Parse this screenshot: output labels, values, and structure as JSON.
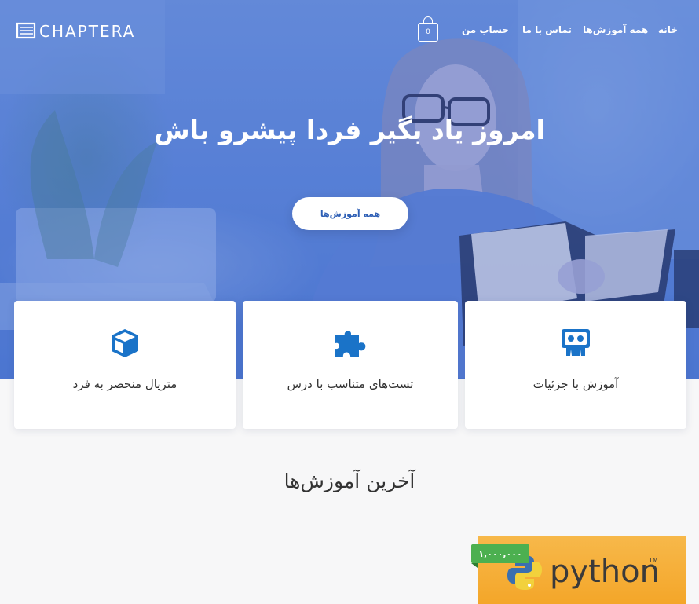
{
  "header": {
    "logo_text": "CHAPTERA",
    "cart_count": "0",
    "nav": {
      "home": "خانه",
      "all_courses": "همه آموزش‌ها",
      "contact": "تماس با ما",
      "account": "حساب من"
    }
  },
  "hero": {
    "title": "امروز یاد بگیر فردا پیشرو باش",
    "button_label": "همه آموزش‌ها"
  },
  "features": [
    {
      "label": "متریال منحصر به فرد",
      "icon": "cube-icon"
    },
    {
      "label": "تست‌های متناسب با درس",
      "icon": "puzzle-icon"
    },
    {
      "label": "آموزش با جزئیات",
      "icon": "presentation-icon"
    }
  ],
  "latest": {
    "title": "آخرین آموزش‌ها",
    "courses": [
      {
        "image_text": "python",
        "trademark": "TM",
        "price": "۱,۰۰۰,۰۰۰"
      }
    ]
  },
  "colors": {
    "accent": "#1a73c8",
    "hero_overlay": "#5f86d8",
    "price_badge": "#4cb050",
    "python_bg": "#f4a629"
  }
}
